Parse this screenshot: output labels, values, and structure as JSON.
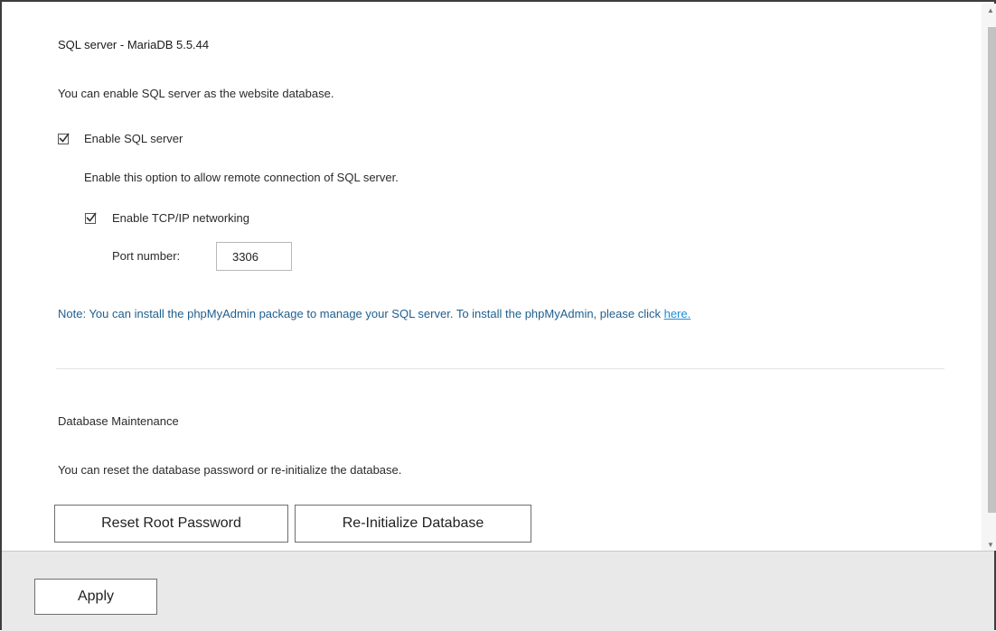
{
  "sql_section": {
    "title": "SQL server - MariaDB 5.5.44",
    "description": "You can enable SQL server as the website database.",
    "enable_sql": {
      "label": "Enable SQL server",
      "checked": true
    },
    "remote_desc": "Enable this option to allow remote connection of SQL server.",
    "enable_tcp": {
      "label": "Enable TCP/IP networking",
      "checked": true
    },
    "port_label": "Port number:",
    "port_value": "3306",
    "note_text": "Note: You can install the phpMyAdmin package to manage your SQL server. To install the phpMyAdmin, please click ",
    "note_link": "here."
  },
  "maintenance": {
    "title": "Database Maintenance",
    "description": "You can reset the database password or re-initialize the database.",
    "reset_button": "Reset Root Password",
    "reinit_button": "Re-Initialize Database"
  },
  "footer": {
    "apply_button": "Apply"
  },
  "colors": {
    "note": "#1f5f8e",
    "link": "#1a8fd8",
    "footer_bg": "#e9e9e9",
    "scroll_thumb": "#c2c2c2"
  }
}
